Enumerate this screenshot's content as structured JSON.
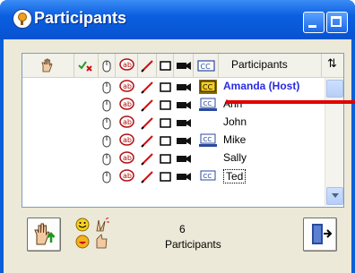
{
  "window": {
    "title": "Participants"
  },
  "list": {
    "header": {
      "participants_label": "Participants"
    },
    "participants": [
      {
        "name": "Amanda (Host)",
        "selected": true,
        "media": "cc-host"
      },
      {
        "name": "Ann",
        "selected": false,
        "media": "cc-screen"
      },
      {
        "name": "John",
        "selected": false,
        "media": ""
      },
      {
        "name": "Mike",
        "selected": false,
        "media": "cc-screen"
      },
      {
        "name": "Sally",
        "selected": false,
        "media": ""
      },
      {
        "name": "Ted",
        "selected": false,
        "media": "cc-box"
      }
    ]
  },
  "footer": {
    "count": "6",
    "count_label": "Participants"
  },
  "colors": {
    "title_bar": "#0b5fe0",
    "selected_name": "#2a2ae0",
    "annotation": "#e00000"
  }
}
